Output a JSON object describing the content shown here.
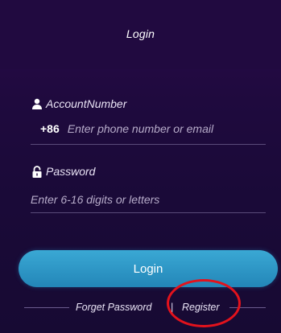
{
  "header": {
    "title": "Login"
  },
  "account": {
    "label": "AccountNumber",
    "icon": "user-icon",
    "country_code": "+86",
    "placeholder": "Enter phone number or email"
  },
  "password": {
    "label": "Password",
    "icon": "lock-icon",
    "placeholder": "Enter 6-16 digits or letters"
  },
  "actions": {
    "login_label": "Login",
    "forget_password_label": "Forget Password",
    "separator": "|",
    "register_label": "Register"
  },
  "colors": {
    "background": "#1f0a3e",
    "button": "#2a92c4",
    "highlight": "#e3121c"
  }
}
